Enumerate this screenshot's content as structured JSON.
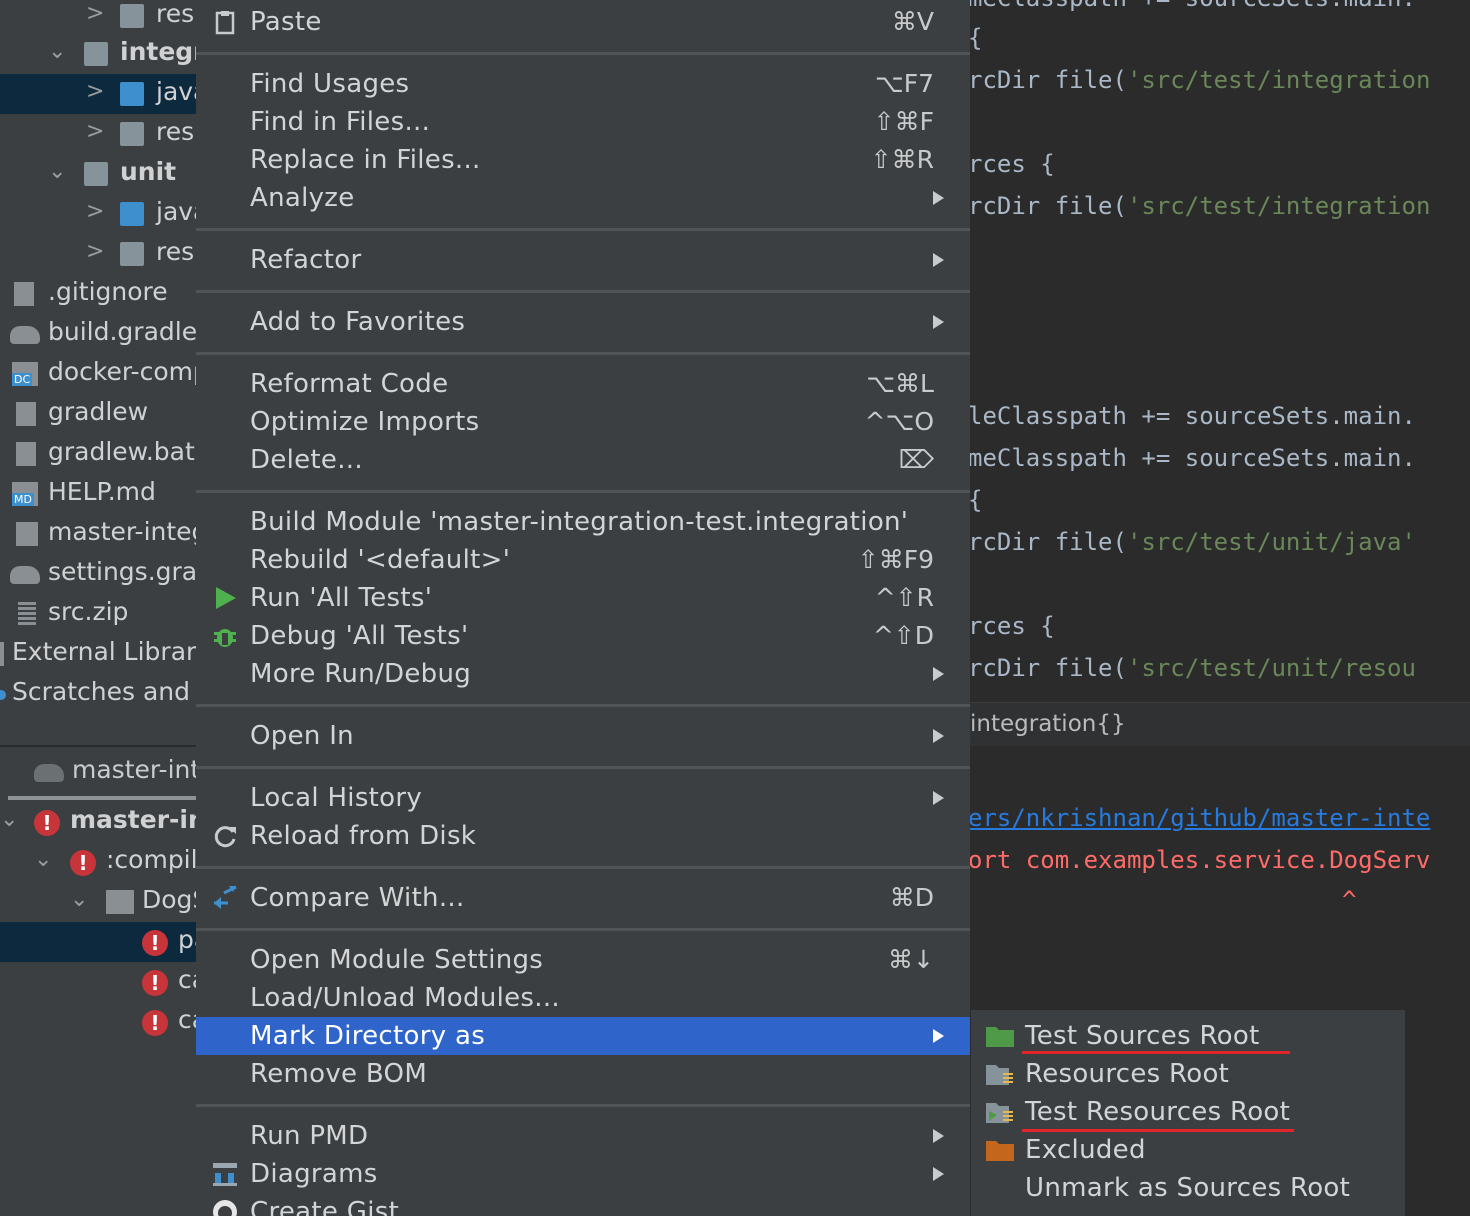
{
  "project_tree": {
    "rows": [
      {
        "label": "res",
        "indent": 2,
        "chevron": ">",
        "icon": "resources-folder-icon",
        "selected": false
      },
      {
        "label": "integr",
        "indent": 1,
        "chevron": "v",
        "icon": "module-folder-icon",
        "selected": false
      },
      {
        "label": "java",
        "indent": 2,
        "chevron": ">",
        "icon": "source-folder-icon",
        "selected": true
      },
      {
        "label": "res",
        "indent": 2,
        "chevron": ">",
        "icon": "resources-folder-icon",
        "selected": false
      },
      {
        "label": "unit",
        "indent": 1,
        "chevron": "v",
        "icon": "module-folder-icon",
        "selected": false
      },
      {
        "label": "java",
        "indent": 2,
        "chevron": ">",
        "icon": "source-folder-icon",
        "selected": false
      },
      {
        "label": "res",
        "indent": 2,
        "chevron": ">",
        "icon": "resources-folder-icon",
        "selected": false
      },
      {
        "label": ".gitignore",
        "indent": 0,
        "chevron": "",
        "icon": "gitignore-file-icon",
        "selected": false
      },
      {
        "label": "build.gradle",
        "indent": 0,
        "chevron": "",
        "icon": "gradle-elephant-icon",
        "selected": false
      },
      {
        "label": "docker-compose",
        "indent": 0,
        "chevron": "",
        "icon": "docker-compose-file-icon",
        "selected": false
      },
      {
        "label": "gradlew",
        "indent": 0,
        "chevron": "",
        "icon": "text-file-icon",
        "selected": false
      },
      {
        "label": "gradlew.bat",
        "indent": 0,
        "chevron": "",
        "icon": "text-file-icon",
        "selected": false
      },
      {
        "label": "HELP.md",
        "indent": 0,
        "chevron": "",
        "icon": "markdown-file-icon",
        "selected": false
      },
      {
        "label": "master-integration",
        "indent": 0,
        "chevron": "",
        "icon": "module-file-icon",
        "selected": false
      },
      {
        "label": "settings.gradle",
        "indent": 0,
        "chevron": "",
        "icon": "gradle-elephant-icon",
        "selected": false
      },
      {
        "label": "src.zip",
        "indent": 0,
        "chevron": "",
        "icon": "zip-file-icon",
        "selected": false
      },
      {
        "label": "External Libraries",
        "indent": -1,
        "chevron": "",
        "icon": "",
        "selected": false
      },
      {
        "label": "Scratches and Consoles",
        "indent": -1,
        "chevron": "",
        "icon": "scratches-icon",
        "selected": false
      }
    ]
  },
  "build_panel": {
    "tab_label": "master-integration",
    "rows": [
      {
        "label": "master-integration",
        "bold": true
      },
      {
        "label": ":compileJava",
        "bold": false
      },
      {
        "label": "DogService.java",
        "bold": false
      },
      {
        "label": "package",
        "bold": false
      },
      {
        "label": "cannot",
        "bold": false
      },
      {
        "label": "cannot",
        "bold": false
      }
    ]
  },
  "editor": {
    "lines": [
      {
        "pre": "meClasspath += sourceSets.main.",
        "str": ""
      },
      {
        "pre": "{",
        "str": ""
      },
      {
        "pre": "rcDir file(",
        "str": "'src/test/integration"
      },
      {
        "pre": "rces {",
        "str": ""
      },
      {
        "pre": "rcDir file(",
        "str": "'src/test/integration"
      },
      {
        "pre": "leClasspath += sourceSets.main.",
        "str": ""
      },
      {
        "pre": "meClasspath += sourceSets.main.",
        "str": ""
      },
      {
        "pre": "{",
        "str": ""
      },
      {
        "pre": "rcDir file(",
        "str": "'src/test/unit/java'"
      },
      {
        "pre": "rces {",
        "str": ""
      },
      {
        "pre": "rcDir file(",
        "str": "'src/test/unit/resou"
      }
    ],
    "breadcrumb": "integration{}",
    "console": {
      "path_link": "ers/nkrishnan/github/master-inte",
      "error_line": "ort com.examples.service.DogServ",
      "caret": "^"
    }
  },
  "context_menu": {
    "items": [
      {
        "label": "Paste",
        "shortcut": "⌘V",
        "submenu": false,
        "icon": "paste-icon"
      },
      {
        "label": "Find Usages",
        "shortcut": "⌥F7",
        "submenu": false
      },
      {
        "label": "Find in Files...",
        "shortcut": "⇧⌘F",
        "submenu": false
      },
      {
        "label": "Replace in Files...",
        "shortcut": "⇧⌘R",
        "submenu": false
      },
      {
        "label": "Analyze",
        "shortcut": "",
        "submenu": true
      },
      {
        "label": "Refactor",
        "shortcut": "",
        "submenu": true
      },
      {
        "label": "Add to Favorites",
        "shortcut": "",
        "submenu": true
      },
      {
        "label": "Reformat Code",
        "shortcut": "⌥⌘L",
        "submenu": false
      },
      {
        "label": "Optimize Imports",
        "shortcut": "^⌥O",
        "submenu": false
      },
      {
        "label": "Delete...",
        "shortcut": "⌦",
        "submenu": false
      },
      {
        "label": "Build Module 'master-integration-test.integration'",
        "shortcut": "",
        "submenu": false
      },
      {
        "label": "Rebuild '<default>'",
        "shortcut": "⇧⌘F9",
        "submenu": false
      },
      {
        "label": "Run 'All Tests'",
        "shortcut": "^⇧R",
        "submenu": false,
        "icon": "run-play-icon"
      },
      {
        "label": "Debug 'All Tests'",
        "shortcut": "^⇧D",
        "submenu": false,
        "icon": "debug-bug-icon"
      },
      {
        "label": "More Run/Debug",
        "shortcut": "",
        "submenu": true
      },
      {
        "label": "Open In",
        "shortcut": "",
        "submenu": true
      },
      {
        "label": "Local History",
        "shortcut": "",
        "submenu": true
      },
      {
        "label": "Reload from Disk",
        "shortcut": "",
        "submenu": false,
        "icon": "reload-icon"
      },
      {
        "label": "Compare With...",
        "shortcut": "⌘D",
        "submenu": false,
        "icon": "compare-arrows-icon"
      },
      {
        "label": "Open Module Settings",
        "shortcut": "⌘↓",
        "submenu": false
      },
      {
        "label": "Load/Unload Modules...",
        "shortcut": "",
        "submenu": false
      },
      {
        "label": "Mark Directory as",
        "shortcut": "",
        "submenu": true,
        "highlighted": true
      },
      {
        "label": "Remove BOM",
        "shortcut": "",
        "submenu": false
      },
      {
        "label": "Run PMD",
        "shortcut": "",
        "submenu": true
      },
      {
        "label": "Diagrams",
        "shortcut": "",
        "submenu": true,
        "icon": "diagram-icon"
      },
      {
        "label": "Create Gist...",
        "shortcut": "",
        "submenu": false,
        "icon": "github-icon"
      }
    ]
  },
  "mark_directory_submenu": {
    "items": [
      {
        "label": "Test Sources Root",
        "icon": "test-sources-folder-icon",
        "underlined": true
      },
      {
        "label": "Resources Root",
        "icon": "resources-root-folder-icon",
        "underlined": false
      },
      {
        "label": "Test Resources Root",
        "icon": "test-resources-root-folder-icon",
        "underlined": true
      },
      {
        "label": "Excluded",
        "icon": "excluded-folder-icon",
        "underlined": false
      },
      {
        "label": "Unmark as Sources Root",
        "icon": "",
        "underlined": false
      }
    ]
  },
  "colors": {
    "menu_highlight": "#2f65ca",
    "annotation_underline": "#e0262b",
    "string_green": "#6a8759",
    "error_red": "#c7353a",
    "link_blue": "#287bde"
  }
}
